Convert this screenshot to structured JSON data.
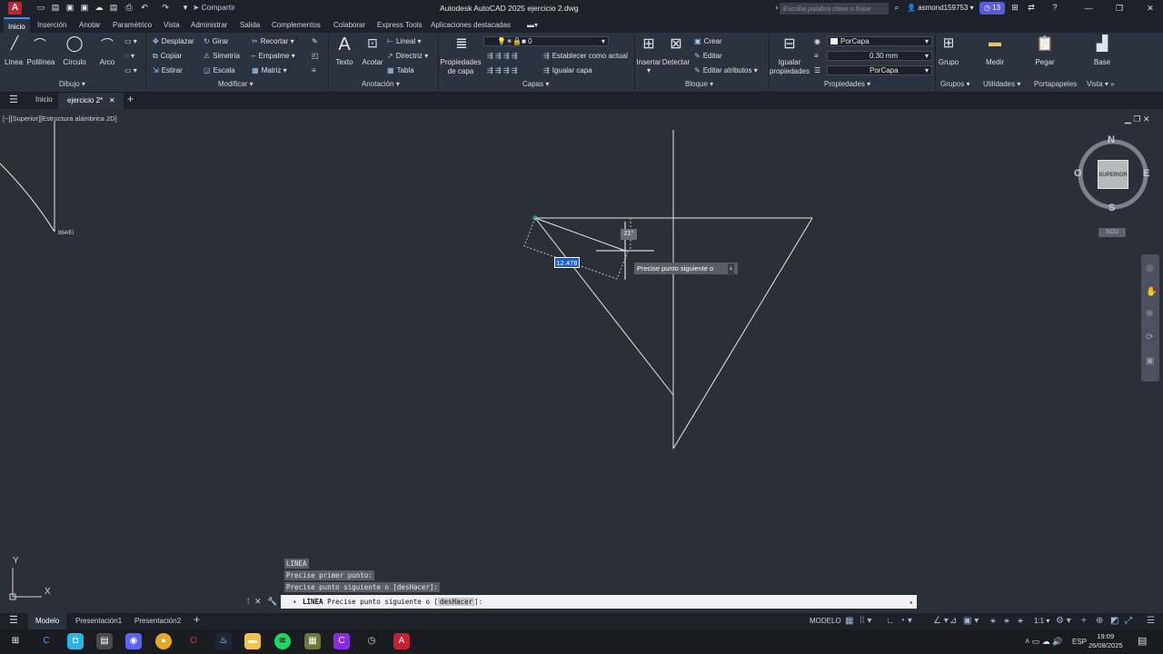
{
  "titlebar": {
    "app_letter": "A",
    "share": "Compartir",
    "title": "Autodesk AutoCAD 2025   ejercicio 2.dwg",
    "search_placeholder": "Escriba palabra clave o frase",
    "user": "asmond159753",
    "notif_count": "13"
  },
  "ribbon_tabs": [
    "Inicio",
    "Inserción",
    "Anotar",
    "Paramétrico",
    "Vista",
    "Administrar",
    "Salida",
    "Complementos",
    "Colaborar",
    "Express Tools",
    "Aplicaciones destacadas"
  ],
  "ribbon": {
    "dibujo": {
      "title": "Dibujo",
      "linea": "Línea",
      "polilinea": "Polilínea",
      "circulo": "Círculo",
      "arco": "Arco"
    },
    "modificar": {
      "title": "Modificar",
      "desplazar": "Desplazar",
      "girar": "Girar",
      "recortar": "Recortar",
      "copiar": "Copiar",
      "simetria": "Simetría",
      "empalme": "Empalme",
      "estirar": "Estirar",
      "escala": "Escala",
      "matriz": "Matriz"
    },
    "anotacion": {
      "title": "Anotación",
      "texto": "Texto",
      "acotar": "Acotar",
      "lineal": "Lineal",
      "directriz": "Directriz",
      "tabla": "Tabla"
    },
    "capas": {
      "title": "Capas",
      "propiedades": "Propiedades",
      "de_capa": "de capa",
      "layer_value": "0",
      "establecer": "Establecer como actual",
      "igualar": "Igualar capa"
    },
    "bloque": {
      "title": "Bloque",
      "insertar": "Insertar",
      "detectar": "Detectar",
      "crear": "Crear",
      "editar": "Editar",
      "editar_atributos": "Editar atributos"
    },
    "propiedades": {
      "title": "Propiedades",
      "igualar": "Igualar",
      "propiedades": "propiedades",
      "color": "PorCapa",
      "lineweight": "0.30 mm",
      "linetype": "PorCapa"
    },
    "grupos": {
      "title": "Grupos",
      "grupo": "Grupo"
    },
    "utilidades": {
      "title": "Utilidades",
      "medir": "Medir"
    },
    "portapapeles": {
      "title": "Portapapeles",
      "pegar": "Pegar"
    },
    "vista": {
      "title": "Vista",
      "base": "Base"
    }
  },
  "filetabs": {
    "home": "Inicio",
    "active": "ejercicio 2*"
  },
  "viewport": {
    "label": "[−][Superior][Estructura alámbrica 2D]",
    "point_label": "864/El",
    "dyn_value": "12.478",
    "angle": "21°",
    "tooltip": "Precise punto siguiente o"
  },
  "viewcube": {
    "north": "N",
    "south": "S",
    "east": "E",
    "west": "O",
    "face": "SUPERIOR",
    "ucs": "SCU"
  },
  "ucs_icon": {
    "x": "X",
    "y": "Y"
  },
  "command": {
    "history": [
      "LINEA",
      "Precise primer punto:",
      "Precise punto siguiente o [desHacer]:"
    ],
    "prompt_cmd": "LINEA",
    "prompt_text": "Precise punto siguiente o [",
    "prompt_option": "desHacer",
    "prompt_end": "]:"
  },
  "statusbar": {
    "model": "Modelo",
    "layout1": "Presentación1",
    "layout2": "Presentación2",
    "mode": "MODELO",
    "scale": "1:1"
  },
  "taskbar": {
    "lang": "ESP",
    "time": "19:09",
    "date": "26/08/2025"
  }
}
